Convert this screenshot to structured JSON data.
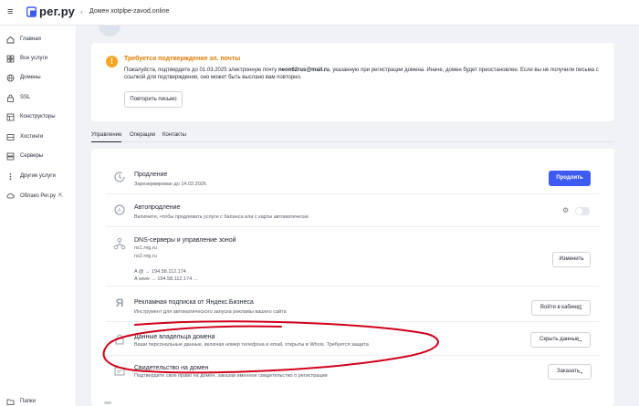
{
  "header": {
    "logo_text": "рег.ру",
    "breadcrumb": "Домен xotplpe-zavod.online"
  },
  "sidebar": {
    "items": [
      {
        "label": "Главная",
        "icon": "home-icon"
      },
      {
        "label": "Все услуги",
        "icon": "grid-icon"
      },
      {
        "label": "Домены",
        "icon": "globe-icon"
      },
      {
        "label": "SSL",
        "icon": "lock-icon"
      },
      {
        "label": "Конструкторы",
        "icon": "layout-icon"
      },
      {
        "label": "Хостинги",
        "icon": "hosting-icon"
      },
      {
        "label": "Серверы",
        "icon": "server-icon"
      },
      {
        "label": "Другие услуги",
        "icon": "more-icon"
      },
      {
        "label": "Облако Рег.ру",
        "icon": "cloud-icon"
      },
      {
        "label": "Папки",
        "icon": "folder-icon"
      }
    ]
  },
  "alert": {
    "title": "Требуется подтверждение эл. почты",
    "text_before": "Пожалуйста, подтвердите до 01.03.2025 электронную почту ",
    "email": "neon62rus@mail.ru",
    "text_after": ", указанную при регистрации домена. Иначе, домен будет приостановлен. Если вы не получили письма с ссылкой для подтверждения, оно может быть выслано вам повторно.",
    "retry_button": "Повторить письмо"
  },
  "tabs": [
    "Управление",
    "Операции",
    "Контакты"
  ],
  "services": {
    "renewal": {
      "title": "Продление",
      "subtitle": "Зарезервирован до 14.02.2026",
      "button": "Продлить"
    },
    "autorenew": {
      "title": "Автопродление",
      "subtitle": "Включите, чтобы продлевать услуги с баланса или с карты автоматически.",
      "enabled": false
    },
    "dns": {
      "title": "DNS-серверы и управление зоной",
      "ns1": "ns1.reg.ru",
      "ns2": "ns2.reg.ru",
      "record_a": "A @ → 194.58.112.174",
      "record_www": "A www → 194.58.112.174 ...",
      "button": "Изменить"
    },
    "yandex": {
      "title": "Рекламная подписка от Яндекс.Бизнеса",
      "subtitle": "Инструмент для автоматического запуска рекламы вашего сайта",
      "button": "Войти в кабинет"
    },
    "owner": {
      "title": "Данные владельца домена",
      "subtitle": "Ваши персональные данные, включая номер телефона и email, открыты в Whois. Требуется защита",
      "button": "Скрыть данные"
    },
    "certificate": {
      "title": "Свидетельство на домен",
      "subtitle": "Подтвердите свое право на домен, заказав именное свидетельство о регистрации",
      "button": "Заказать"
    }
  },
  "colors": {
    "accent": "#3d5af1",
    "warning": "#f5a623",
    "annotation": "#d0021b"
  }
}
